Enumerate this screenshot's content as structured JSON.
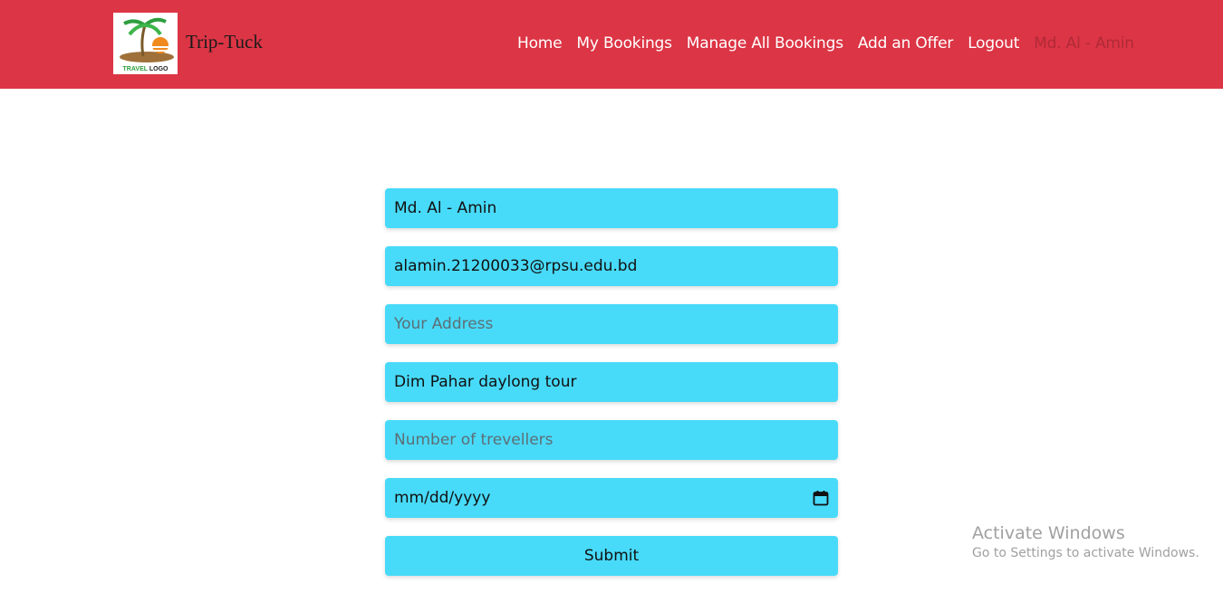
{
  "header": {
    "logo_text_travel": "TRAVEL",
    "logo_text_logo": "LOGO",
    "brand_name": "Trip-Tuck",
    "nav_links": [
      "Home",
      "My Bookings",
      "Manage All Bookings",
      "Add an Offer",
      "Logout"
    ],
    "user_name": "Md. Al - Amin",
    "colors": {
      "navbar_bg": "#dc3545",
      "user_name": "#b02a37"
    }
  },
  "form": {
    "name_value": "Md. Al - Amin",
    "email_value": "alamin.21200033@rpsu.edu.bd",
    "address_placeholder": "Your Address",
    "tour_value": "Dim Pahar daylong tour",
    "travellers_placeholder": "Number of trevellers",
    "date_placeholder": "mm/dd/yyyy",
    "submit_label": "Submit",
    "colors": {
      "field_bg": "#48daf9"
    },
    "icons": {
      "date": "calendar-icon"
    }
  },
  "watermark": {
    "title": "Activate Windows",
    "subtitle": "Go to Settings to activate Windows."
  }
}
